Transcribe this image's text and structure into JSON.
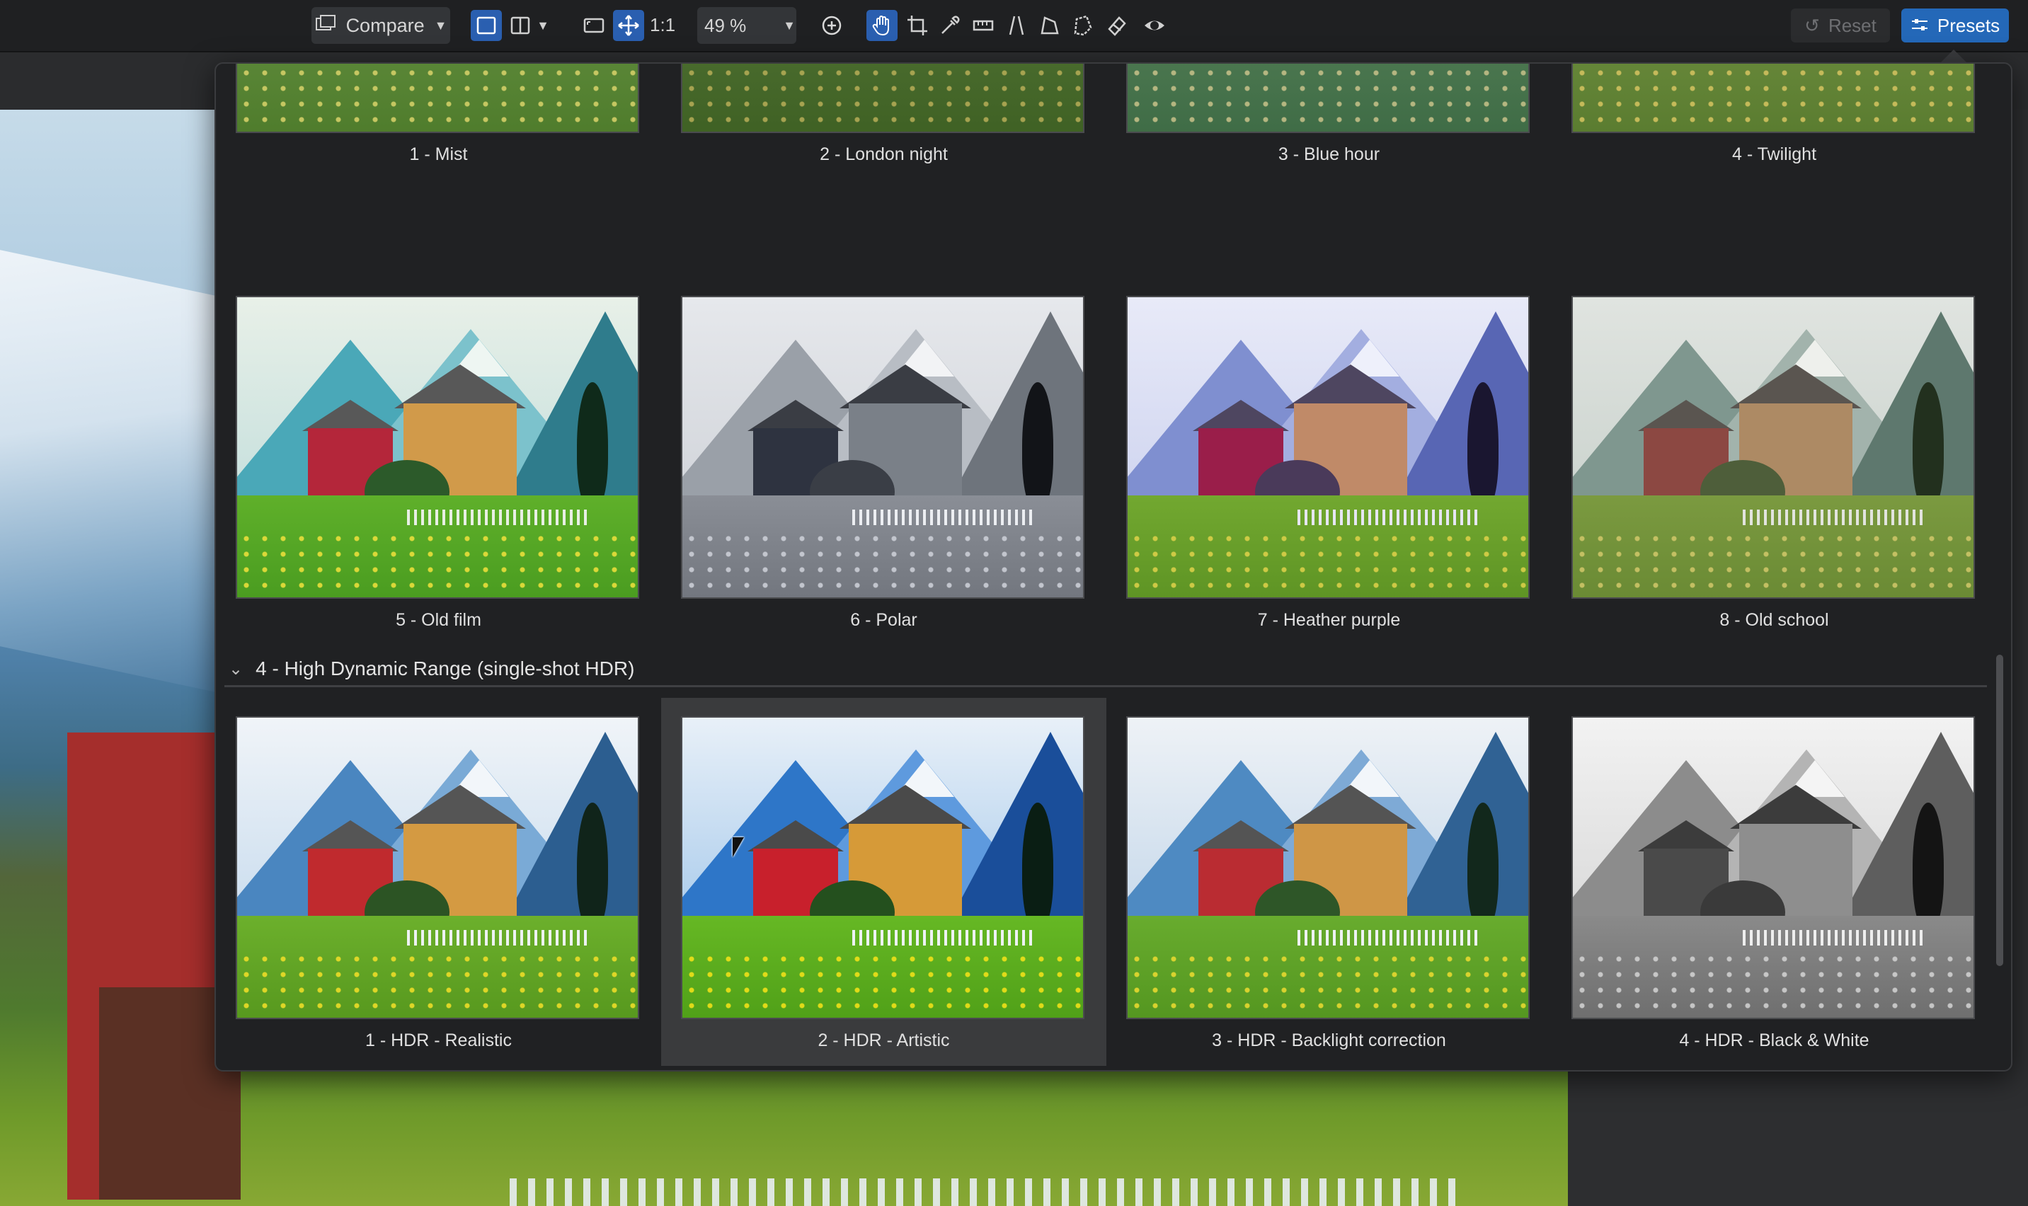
{
  "toolbar": {
    "compare_label": "Compare",
    "zoom_value": "49 %",
    "one_to_one": "1:1",
    "reset_label": "Reset",
    "presets_label": "Presets",
    "icons": [
      "compare-icon",
      "single-view-icon",
      "split-view-icon",
      "fit-icon",
      "move-icon",
      "zoom-in-icon",
      "hand-icon",
      "crop-icon",
      "eyedropper-icon",
      "straighten-icon",
      "perspective-icon",
      "polygon-icon",
      "lasso-icon",
      "eraser-icon",
      "preview-eye-icon"
    ]
  },
  "presets": {
    "row1": [
      {
        "name": "1 - Mist"
      },
      {
        "name": "2 - London night"
      },
      {
        "name": "3 - Blue hour"
      },
      {
        "name": "4 - Twilight"
      }
    ],
    "row2": [
      {
        "name": "5 - Old film"
      },
      {
        "name": "6 - Polar"
      },
      {
        "name": "7 - Heather purple"
      },
      {
        "name": "8 - Old school"
      }
    ],
    "section": {
      "title": "4 - High Dynamic Range (single-shot HDR)",
      "expanded": true
    },
    "row3": [
      {
        "name": "1 - HDR - Realistic"
      },
      {
        "name": "2 - HDR - Artistic",
        "hovered": true
      },
      {
        "name": "3 - HDR - Backlight correction"
      },
      {
        "name": "4 - HDR - Black & White"
      }
    ]
  },
  "colors": {
    "accent": "#2468b8",
    "panel_bg": "#202123"
  }
}
